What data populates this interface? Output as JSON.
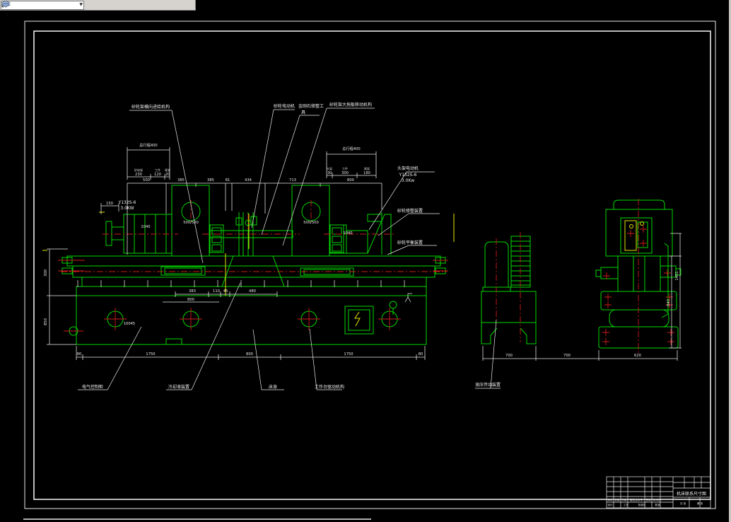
{
  "toolbar": {
    "combo_value": "",
    "icons": [
      "layer-properties-icon",
      "layers-icon"
    ]
  },
  "labels": {
    "t1": "砂轮架横向进给机构",
    "t2": "砂轮电动机",
    "t3a": "金刚石修整工",
    "t3b": "具",
    "t4": "砂轮架大拖板移动机构",
    "r1a": "头架电动机",
    "r1b": "Y132S-6",
    "r1c": "3.0Kw",
    "r2": "砂轮修整装置",
    "r3": "砂轮平衡装置",
    "b1": "电气控制柜",
    "b2": "冷却液装置",
    "b3": "床身",
    "b4": "工作台驱动机构",
    "b5": "液压传动装置",
    "motor1": "Y132S-6",
    "motor2": "3.0KW",
    "head_left": "500/500",
    "head_right": "500/500",
    "part1": "1040",
    "part2": "1040",
    "part_bed": "10045"
  },
  "dims": {
    "mid_chain": [
      "500",
      "385",
      "385",
      "81",
      "434",
      "713",
      "800"
    ],
    "left_cluster": {
      "header": "总行程400",
      "pairs": [
        [
          "砂轮架",
          "230"
        ],
        [
          "工件",
          "120"
        ],
        [
          "尾架",
          "20"
        ]
      ]
    },
    "right_cluster": {
      "header": "总行程400",
      "pairs": [
        [
          "头架",
          "30"
        ],
        [
          "工件",
          "300"
        ],
        [
          "尾架",
          "180"
        ]
      ]
    },
    "d150": "150",
    "upper": [
      "383",
      "110",
      "45",
      "480",
      "800"
    ],
    "bottom": [
      "80",
      "1750",
      "800",
      "1750",
      "80"
    ],
    "v_left": [
      "300",
      "850"
    ],
    "v_right": [
      "943",
      "1451"
    ],
    "right_bottom": [
      "700",
      "700",
      "620"
    ]
  },
  "title_block": {
    "title": "机床联系尺寸图",
    "mark": "标记",
    "count": "处数",
    "zone": "分区",
    "doc": "更改文件号",
    "sign": "签名",
    "date": "年月日",
    "design": "设计",
    "tech": "工艺",
    "standard": "标准化",
    "approve": "批准",
    "sheet_total": "共 张",
    "sheet_no": "第 张"
  }
}
